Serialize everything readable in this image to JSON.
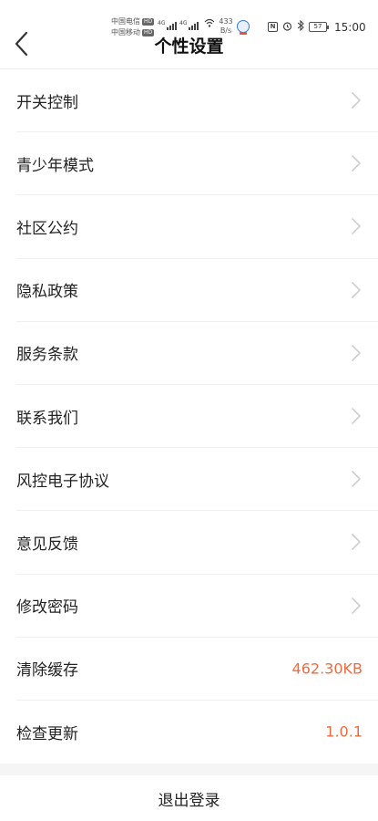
{
  "status_bar": {
    "carrier_1": "中国电信",
    "carrier_2": "中国移动",
    "hd_label": "HD",
    "network_1": "4G",
    "network_2": "4G",
    "speed_value": "433",
    "speed_unit": "B/s",
    "battery": "57",
    "time": "15:00"
  },
  "header": {
    "title": "个性设置",
    "back_icon": "chevron-left-icon"
  },
  "settings": {
    "items": [
      {
        "label": "开关控制"
      },
      {
        "label": "青少年模式"
      },
      {
        "label": "社区公约"
      },
      {
        "label": "隐私政策"
      },
      {
        "label": "服务条款"
      },
      {
        "label": "联系我们"
      },
      {
        "label": "风控电子协议"
      },
      {
        "label": "意见反馈"
      },
      {
        "label": "修改密码"
      },
      {
        "label": "清除缓存",
        "value": "462.30KB"
      },
      {
        "label": "检查更新",
        "value": "1.0.1"
      }
    ]
  },
  "footer": {
    "logout_label": "退出登录"
  },
  "colors": {
    "accent": "#ef6b3f",
    "divider": "#f0f0f0",
    "band": "#f5f5f5"
  }
}
